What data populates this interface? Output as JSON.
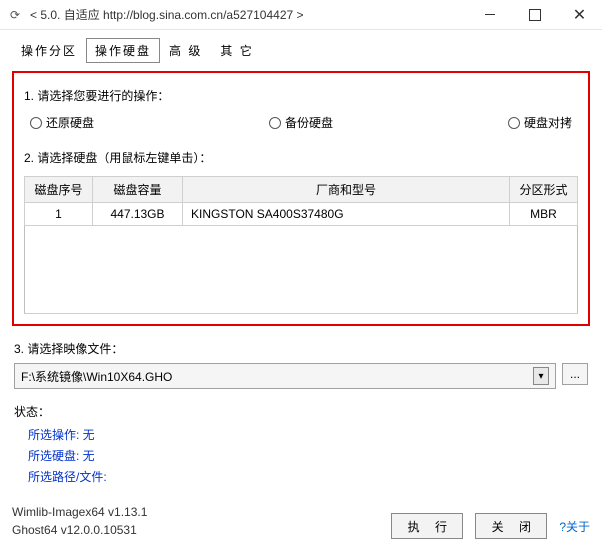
{
  "title": "< 5.0.    自适应 http://blog.sina.com.cn/a527104427  >",
  "tabs": [
    "操作分区",
    "操作硬盘",
    "高 级",
    "其 它"
  ],
  "activeTab": 1,
  "section1": {
    "label": "1. 请选择您要进行的操作：",
    "options": [
      "还原硬盘",
      "备份硬盘",
      "硬盘对拷"
    ]
  },
  "section2": {
    "label": "2. 请选择硬盘（用鼠标左键单击）：",
    "headers": [
      "磁盘序号",
      "磁盘容量",
      "厂商和型号",
      "分区形式"
    ],
    "rows": [
      {
        "num": "1",
        "cap": "447.13GB",
        "model": "KINGSTON SA400S37480G",
        "part": "MBR"
      }
    ]
  },
  "section3": {
    "label": "3. 请选择映像文件：",
    "value": "F:\\系统镜像\\Win10X64.GHO"
  },
  "status": {
    "title": "状态：",
    "lines": [
      "所选操作: 无",
      "所选硬盘: 无",
      "所选路径/文件:"
    ]
  },
  "version": {
    "line1": "Wimlib-Imagex64 v1.13.1",
    "line2": "Ghost64 v12.0.0.10531"
  },
  "buttons": {
    "run": "执 行",
    "close": "关 闭",
    "about": "?关于"
  },
  "browseDots": "..."
}
